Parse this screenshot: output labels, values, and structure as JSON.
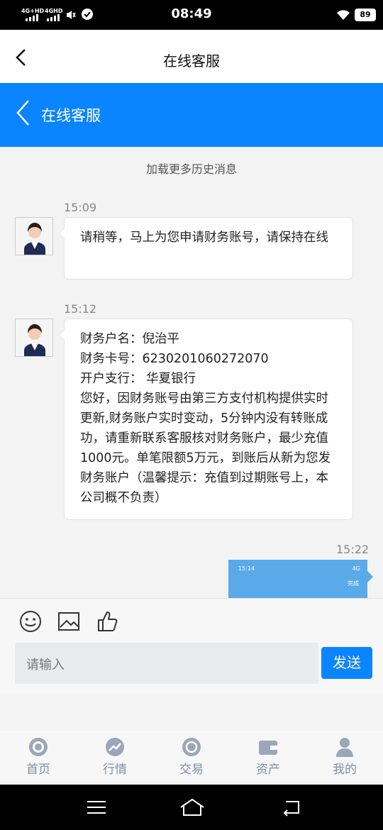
{
  "status_bar": {
    "time": "08:49",
    "network_1": "4G+HD",
    "network_2": "4GHD",
    "battery": "89"
  },
  "header": {
    "title": "在线客服"
  },
  "blue_header": {
    "title": "在线客服"
  },
  "chat": {
    "load_more": "加载更多历史消息",
    "messages": [
      {
        "time": "15:09",
        "lines": [
          "请稍等，马上为您申请财务账号，请保持在线"
        ]
      },
      {
        "time": "15:12",
        "lines": [
          "财务户名：倪治平",
          "财务卡号：6230201060272070",
          "开户支行： 华夏银行",
          "您好，因财务账号由第三方支付机构提供实时更新,财务账户实时变动，5分钟内没有转账成功，请重新联系客服核对财务账户，最少充值1000元。单笔限额5万元，到账后从新为您发财务账户（温馨提示：充值到过期账号上，本公司概不负责）"
        ]
      },
      {
        "time": "15:22",
        "image_time": "15:14",
        "image_status": "4G",
        "image_done": "完成"
      }
    ]
  },
  "composer": {
    "placeholder": "请输入",
    "send_label": "发送"
  },
  "tabs": [
    {
      "label": "首页",
      "icon": "home-icon"
    },
    {
      "label": "行情",
      "icon": "chart-icon"
    },
    {
      "label": "交易",
      "icon": "exchange-icon"
    },
    {
      "label": "资产",
      "icon": "wallet-icon"
    },
    {
      "label": "我的",
      "icon": "user-icon"
    }
  ],
  "colors": {
    "accent": "#0a84ff",
    "tab_inactive": "#7e8fa7"
  }
}
